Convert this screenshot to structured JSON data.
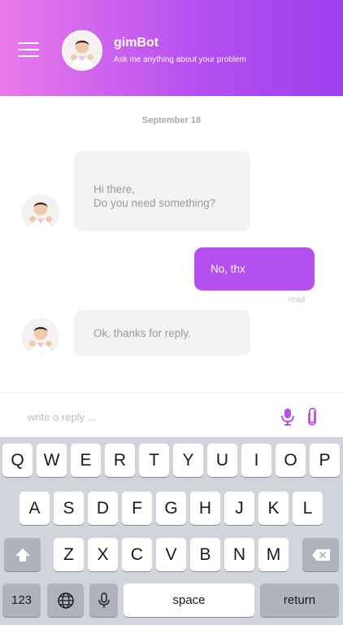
{
  "header": {
    "bot_name": "gimBot",
    "subtitle": "Ask me anything about your problem",
    "menu_icon": "hamburger-menu-icon",
    "gradient_start": "#e97ae9",
    "gradient_end": "#9d40ee"
  },
  "chat": {
    "date": "September 18",
    "messages": [
      {
        "from": "bot",
        "lines": [
          "Hi there,",
          "Do you need something?"
        ]
      },
      {
        "from": "user",
        "text": "No, thx",
        "status": "read"
      },
      {
        "from": "bot",
        "text": "Ok, thanks for reply."
      }
    ],
    "accent_color": "#b54ff0"
  },
  "reply": {
    "placeholder": "write o reply ...",
    "mic_icon": "microphone-icon",
    "attach_icon": "paperclip-icon"
  },
  "keyboard": {
    "row1": [
      "Q",
      "W",
      "E",
      "R",
      "T",
      "Y",
      "U",
      "I",
      "O",
      "P"
    ],
    "row2": [
      "A",
      "S",
      "D",
      "F",
      "G",
      "H",
      "J",
      "K",
      "L"
    ],
    "row3": [
      "Z",
      "X",
      "C",
      "V",
      "B",
      "N",
      "M"
    ],
    "numbers_label": "123",
    "space_label": "space",
    "return_label": "return"
  }
}
